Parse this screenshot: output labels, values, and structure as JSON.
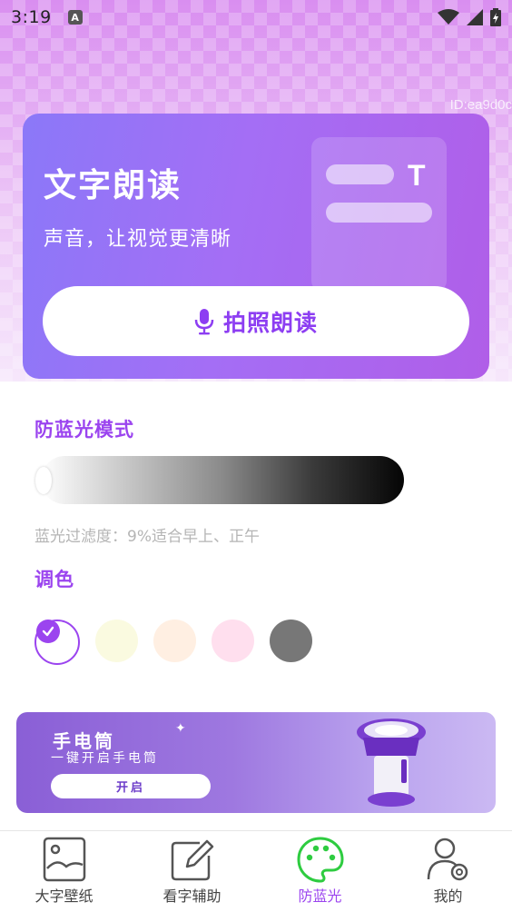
{
  "status": {
    "time": "3:19",
    "notif_icon": "A"
  },
  "watermark": "ID:ea9d0c",
  "hero": {
    "title": "文字朗读",
    "subtitle": "声音，让视觉更清晰",
    "card_letter": "T",
    "button_label": "拍照朗读"
  },
  "blue_light": {
    "title": "防蓝光模式",
    "filter_text": "蓝光过滤度：9%适合早上、正午",
    "filter_level": 0.09
  },
  "color": {
    "title": "调色",
    "swatches": [
      "#ffffff",
      "#fafae0",
      "#ffefe2",
      "#ffdfee",
      "#777777"
    ],
    "selected_index": 0
  },
  "banner": {
    "title": "手电筒",
    "subtitle": "一键开启手电筒",
    "button_label": "开启"
  },
  "tabs": [
    {
      "label": "大字壁纸",
      "icon": "image-icon"
    },
    {
      "label": "看字辅助",
      "icon": "edit-icon"
    },
    {
      "label": "防蓝光",
      "icon": "palette-icon",
      "active": true
    },
    {
      "label": "我的",
      "icon": "user-settings-icon"
    }
  ],
  "colors": {
    "accent": "#9b44ef",
    "active_tab": "#2ecc40"
  }
}
